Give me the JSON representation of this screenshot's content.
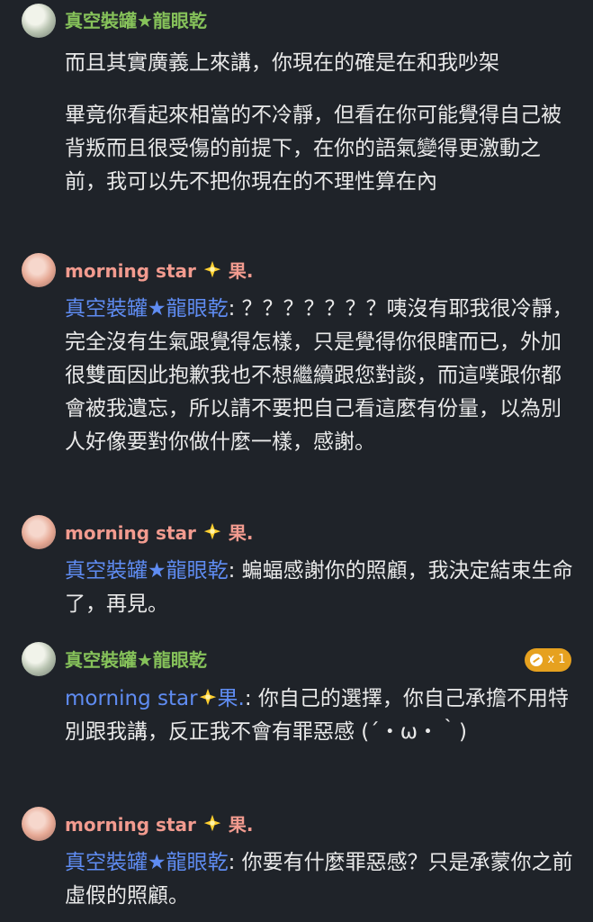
{
  "messages": [
    {
      "author": "真空裝罐★龍眼乾",
      "lines": [
        "而且其實廣義上來講，你現在的確是在和我吵架",
        "畢竟你看起來相當的不冷靜，但看在你可能覺得自己被背叛而且很受傷的前提下，在你的語氣變得更激動之前，我可以先不把你現在的不理性算在內"
      ]
    },
    {
      "author_name": "morning star",
      "author_suffix": "果.",
      "mention": "真空裝罐★龍眼乾",
      "text": ": ？？？？？？？咦沒有耶我很冷靜，完全沒有生氣跟覺得怎樣，只是覺得你很瞎而已，外加很雙面因此抱歉我也不想繼續跟您對談，而這噗跟你都會被我遺忘，所以請不要把自己看這麼有份量，以為別人好像要對你做什麼一樣，感謝。"
    },
    {
      "author_name": "morning star",
      "author_suffix": "果.",
      "mention": "真空裝罐★龍眼乾",
      "text": ": 蝙蝠感謝你的照顧，我決定結束生命了，再見。"
    },
    {
      "author": "真空裝罐★龍眼乾",
      "reaction_count": "x 1",
      "mention_name": "morning star",
      "mention_suffix": "果.",
      "text": ": 你自己的選擇，你自己承擔不用特別跟我講，反正我不會有罪惡感 (´・ω・｀)"
    },
    {
      "author_name": "morning star",
      "author_suffix": "果.",
      "mention": "真空裝罐★龍眼乾",
      "text": ": 你要有什麼罪惡感？只是承蒙你之前虛假的照顧。"
    }
  ],
  "icons": {
    "sparkle": "sparkle-star-emoji",
    "reaction": "reaction-icon"
  },
  "colors": {
    "background": "#1f2329",
    "green_name": "#86c25a",
    "pink_name": "#f29b8f",
    "mention": "#5f8cf2",
    "reaction": "#e6a11f"
  }
}
